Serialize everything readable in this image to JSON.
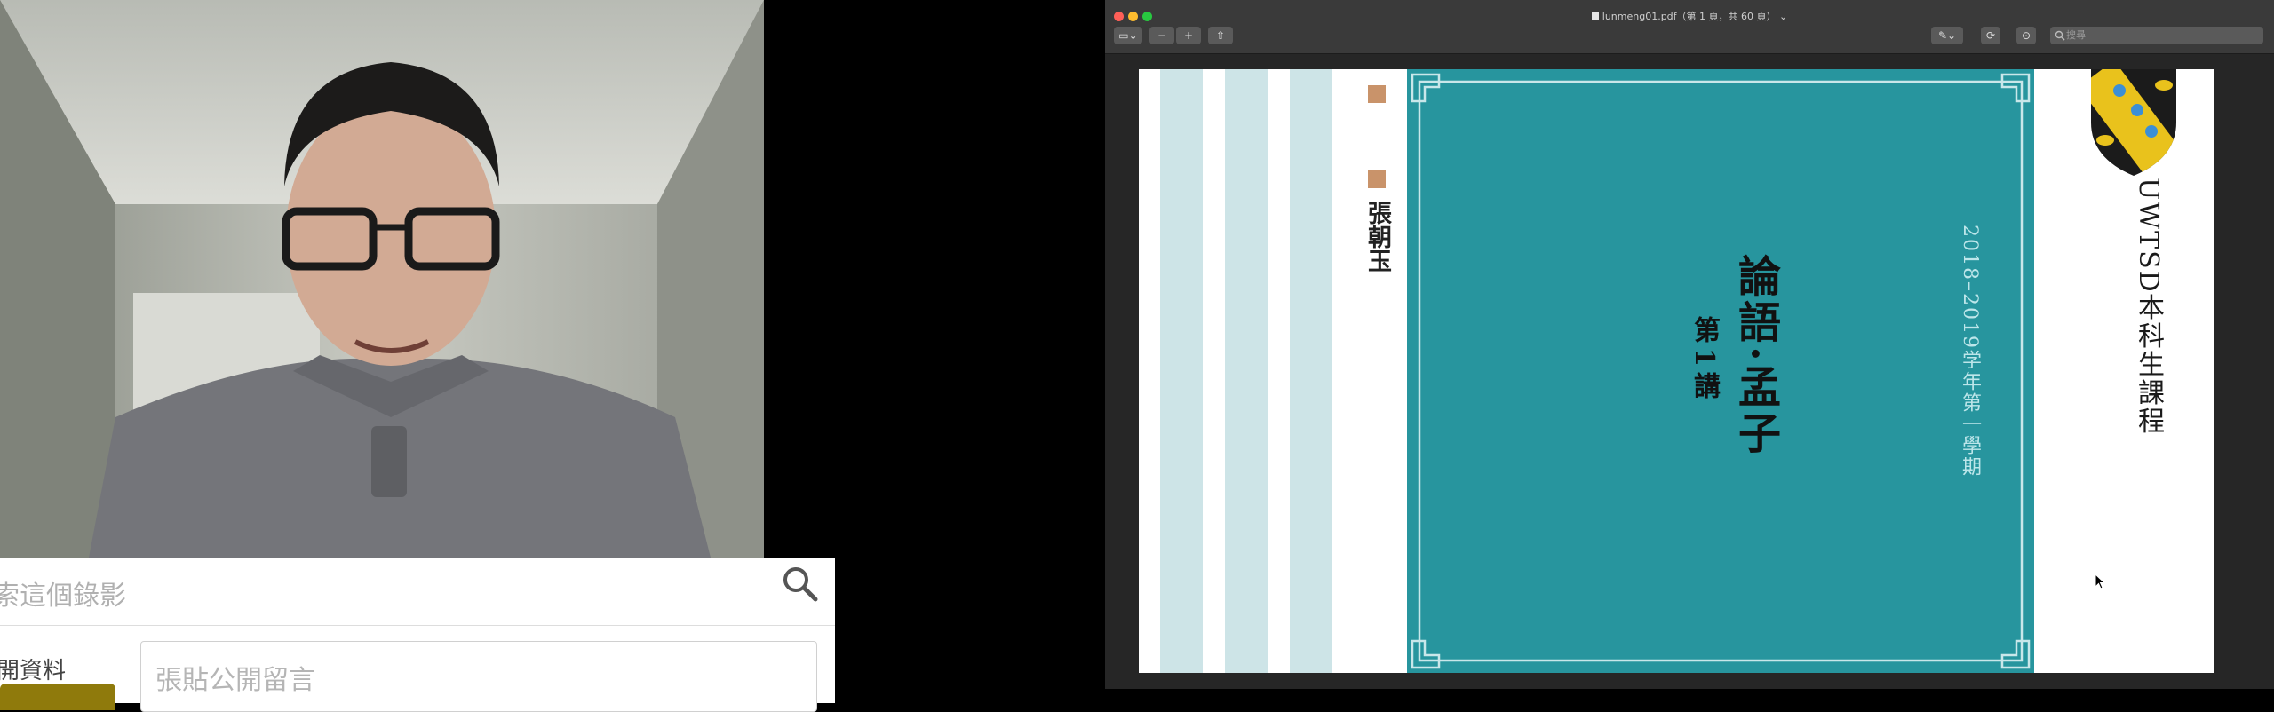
{
  "left_panel": {
    "search": {
      "placeholder": "索這個錄影"
    },
    "comment": {
      "profile_label": "開資料",
      "input_placeholder": "張貼公開留言"
    }
  },
  "pdf_viewer": {
    "window_title": "lunmeng01.pdf（第 1 頁，共 60 頁）",
    "window_title_chevron": "⌄",
    "search_placeholder": "搜尋",
    "toolbar": {
      "sidebar_glyph": "▭⌄",
      "zoom_out_glyph": "−",
      "zoom_in_glyph": "+",
      "share_glyph": "⇧",
      "markup_glyph": "✎⌄",
      "rotate_glyph": "⟳",
      "annotate_glyph": "⊙"
    },
    "page": {
      "author": "張朝玉",
      "course_title": "論語·孟子",
      "lecture": "第1講",
      "term": "2018–2019学年第一學期",
      "institution": "UWTSD本科生課程"
    }
  },
  "colors": {
    "teal": "#27959e",
    "stripe": "#cde4e7",
    "accent_square": "#c9936a",
    "gold_button": "#8f7a0c",
    "crest_yellow": "#e9c21c"
  }
}
